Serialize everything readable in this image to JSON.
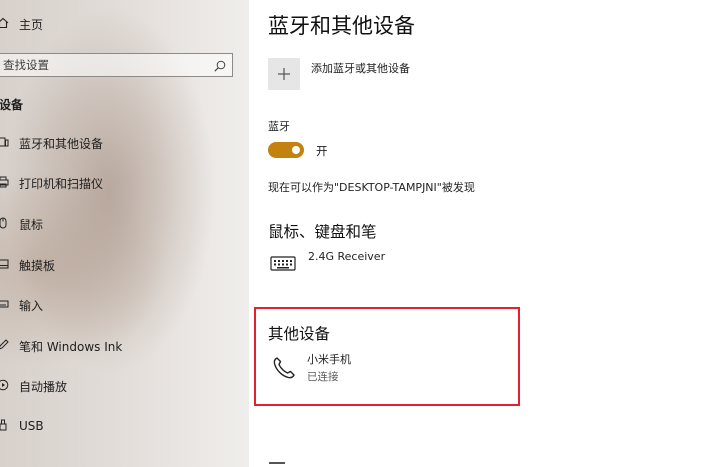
{
  "sidebar": {
    "home_label": "主页",
    "search": {
      "placeholder": "查找设置"
    },
    "section_heading": "设备",
    "items": [
      {
        "label": "蓝牙和其他设备",
        "icon": "bluetooth-devices-icon"
      },
      {
        "label": "打印机和扫描仪",
        "icon": "printer-icon"
      },
      {
        "label": "鼠标",
        "icon": "mouse-icon"
      },
      {
        "label": "触摸板",
        "icon": "touchpad-icon"
      },
      {
        "label": "输入",
        "icon": "keyboard-icon"
      },
      {
        "label": "笔和 Windows Ink",
        "icon": "pen-icon"
      },
      {
        "label": "自动播放",
        "icon": "autoplay-icon"
      },
      {
        "label": "USB",
        "icon": "usb-icon"
      }
    ]
  },
  "main": {
    "title": "蓝牙和其他设备",
    "add_device_label": "添加蓝牙或其他设备",
    "bluetooth": {
      "label": "蓝牙",
      "state_label": "开",
      "on": true,
      "accent_color": "#c3810f"
    },
    "discoverable_text": "现在可以作为\"DESKTOP-TAMPJNI\"被发现",
    "mouse_section": {
      "title": "鼠标、键盘和笔",
      "devices": [
        {
          "name": "2.4G Receiver",
          "icon": "keyboard-icon"
        }
      ]
    },
    "other_section": {
      "title": "其他设备",
      "highlight_color": "#e5202e",
      "devices": [
        {
          "name": "小米手机",
          "status": "已连接",
          "icon": "phone-icon"
        }
      ]
    }
  }
}
